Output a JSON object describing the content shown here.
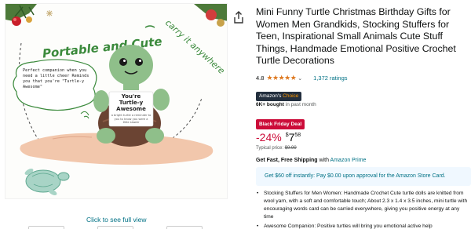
{
  "image": {
    "headline": "Portable and Cute",
    "tagline": "carry it anywhere",
    "bubble_text": "Perfect companion when you need a little cheer Reminds you that you're \"Turtle-y Awesome\"",
    "card_title": "You're Turtle-y Awesome",
    "card_small": "a bright turtle a reminder to you to know you were a little slower"
  },
  "image_link": "Click to see full view",
  "product": {
    "title": "Mini Funny Turtle Christmas Birthday Gifts for Women Men Grandkids, Stocking Stuffers for Teen, Inspirational Small Animals Cute Stuff Things, Handmade Emotional Positive Crochet Turtle Decorations",
    "rating_value": "4.8",
    "stars": "★★★★★",
    "ratings_count": "1,372 ratings",
    "choice_prefix": "Amazon's",
    "choice_accent": "Choice",
    "bought_bold": "6K+ bought",
    "bought_rest": "in past month",
    "deal_label": "Black Friday Deal",
    "discount": "-24%",
    "price_symbol": "$",
    "price_whole": "7",
    "price_fraction": "58",
    "typical_label": "Typical price:",
    "typical_price": "$9.99",
    "shipping_bold": "Get Fast, Free Shipping",
    "shipping_with": "with",
    "shipping_prime": "Amazon Prime",
    "promo": "Get $60 off instantly: Pay $0.00 upon approval for the Amazon Store Card.",
    "bullets": [
      "Stocking Stuffers for Men Women: Handmade Crochet Cute turtle dolls are knitted from wool yarn, with a soft and comfortable touch; About 2.3 x 1.4 x 3.5 inches, mini turtle with encouraging words card can be carried everywhere, giving you positive energy at any time",
      "Awesome Companion: Positive turtles will bring you emotional active help"
    ]
  },
  "colors": {
    "deal_red": "#cc0c39",
    "link_teal": "#007185",
    "star_orange": "#de7921",
    "choice_navy": "#232f3e",
    "turtle_green": "#8fbf8a",
    "shell_brown": "#6b4433"
  },
  "icons": [
    "share-icon",
    "chevron-down-icon",
    "ornament-icon",
    "snowflake-icon"
  ]
}
